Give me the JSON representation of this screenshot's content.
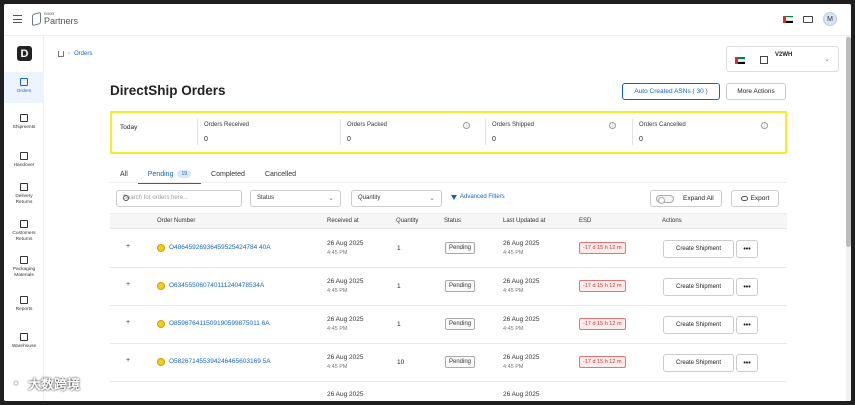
{
  "topbar": {
    "logo_small": "noon",
    "logo_big": "Partners",
    "avatar_initial": "M"
  },
  "sidebar": {
    "logo_letter": "D",
    "items": [
      {
        "label": "Orders",
        "icon": "orders-icon",
        "active": true
      },
      {
        "label": "Shipments",
        "icon": "truck-icon"
      },
      {
        "label": "Handover",
        "icon": "handover-icon"
      },
      {
        "label": "Delivery Returns",
        "icon": "delivery-returns-icon"
      },
      {
        "label": "Customers Returns",
        "icon": "customer-returns-icon"
      },
      {
        "label": "Packaging Materials",
        "icon": "box-icon"
      },
      {
        "label": "Reports",
        "icon": "reports-icon"
      },
      {
        "label": "Warehouse",
        "icon": "warehouse-icon"
      }
    ]
  },
  "breadcrumb": {
    "current": "Orders"
  },
  "warehouse": {
    "name": "V2WH"
  },
  "page": {
    "title": "DirectShip Orders",
    "auto_asn_label": "Auto Created ASNs ( 30 )",
    "more_actions_label": "More Actions"
  },
  "stats": {
    "period": "Today",
    "items": [
      {
        "label": "Orders Received",
        "value": "0"
      },
      {
        "label": "Orders Packed",
        "value": "0"
      },
      {
        "label": "Orders Shipped",
        "value": "0"
      },
      {
        "label": "Orders Cancelled",
        "value": "0"
      }
    ]
  },
  "tabs": [
    {
      "label": "All"
    },
    {
      "label": "Pending",
      "badge": "19",
      "active": true
    },
    {
      "label": "Completed"
    },
    {
      "label": "Cancelled"
    }
  ],
  "filters": {
    "search_placeholder": "Search for orders here...",
    "status_label": "Status",
    "quantity_label": "Quantity",
    "advanced_label": "Advanced Filters",
    "expand_all_label": "Expand All",
    "export_label": "Export"
  },
  "table": {
    "headers": [
      "Order Number",
      "Received at",
      "Quantity",
      "Status",
      "Last Updated at",
      "ESD",
      "Actions"
    ],
    "rows": [
      {
        "order": "O48645926936459525424784 40A",
        "received_date": "26 Aug 2025",
        "received_time": "4:45 PM",
        "qty": "1",
        "status": "Pending",
        "updated_date": "26 Aug 2025",
        "updated_time": "4:45 PM",
        "esd": "-17 d 15 h 12 m"
      },
      {
        "order": "O634555060740111240478534A",
        "received_date": "26 Aug 2025",
        "received_time": "4:45 PM",
        "qty": "1",
        "status": "Pending",
        "updated_date": "26 Aug 2025",
        "updated_time": "4:45 PM",
        "esd": "-17 d 15 h 12 m"
      },
      {
        "order": "O859676411509190599875011 6A",
        "received_date": "26 Aug 2025",
        "received_time": "4:45 PM",
        "qty": "1",
        "status": "Pending",
        "updated_date": "26 Aug 2025",
        "updated_time": "4:45 PM",
        "esd": "-17 d 15 h 12 m"
      },
      {
        "order": "O582671455394246465603169 5A",
        "received_date": "26 Aug 2025",
        "received_time": "4:45 PM",
        "qty": "10",
        "status": "Pending",
        "updated_date": "26 Aug 2025",
        "updated_time": "4:45 PM",
        "esd": "-17 d 15 h 12 m"
      },
      {
        "order": "",
        "received_date": "26 Aug 2025",
        "received_time": "",
        "qty": "",
        "status": "",
        "updated_date": "26 Aug 2025",
        "updated_time": "",
        "esd": ""
      }
    ],
    "create_shipment_label": "Create Shipment",
    "more_label": "•••"
  },
  "watermark": {
    "text": "大数跨境"
  },
  "colors": {
    "accent": "#1565c0",
    "highlight": "#f4ee2a",
    "esd_red": "#d32f2f"
  }
}
